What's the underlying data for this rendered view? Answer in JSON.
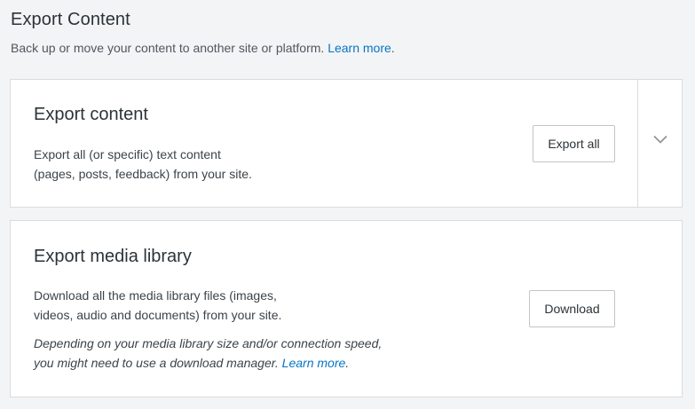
{
  "header": {
    "title": "Export Content",
    "subtitle": "Back up or move your content to another site or platform.",
    "learn_more": "Learn more",
    "learn_more_suffix": "."
  },
  "export_content": {
    "title": "Export content",
    "description_line1": "Export all (or specific) text content",
    "description_line2": "(pages, posts, feedback) from your site.",
    "button_label": "Export all",
    "expand_icon": "chevron-down-icon"
  },
  "media_library": {
    "title": "Export media library",
    "description_line1": "Download all the media library files (images,",
    "description_line2": "videos, audio and documents) from your site.",
    "note_line1": "Depending on your media library size and/or connection speed,",
    "note_line2": "you might need to use a download manager.",
    "learn_more": "Learn more",
    "learn_more_suffix": ".",
    "button_label": "Download"
  },
  "colors": {
    "background": "#f3f4f5",
    "card": "#ffffff",
    "border": "#dcdcde",
    "link": "#0675c4",
    "text": "#3c434a"
  }
}
